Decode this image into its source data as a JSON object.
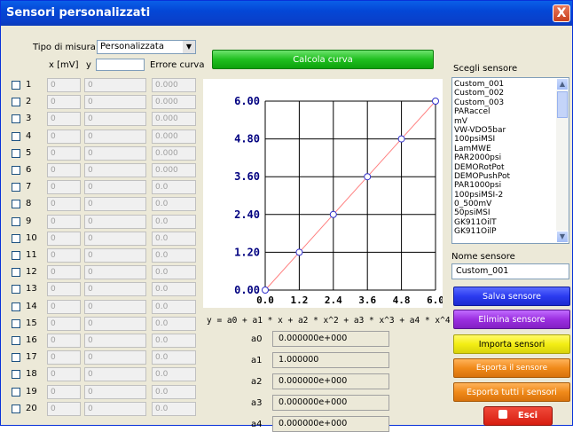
{
  "window": {
    "title": "Sensori personalizzati",
    "close_glyph": "X"
  },
  "measure": {
    "label": "Tipo di misura",
    "selected": "Personalizzata",
    "arrow": "▼"
  },
  "columns": {
    "x": "x [mV]",
    "y": "y",
    "err": "Errore curva"
  },
  "rows": [
    {
      "num": "1",
      "x": "0",
      "y": "0",
      "err": "0.000"
    },
    {
      "num": "2",
      "x": "0",
      "y": "0",
      "err": "0.000"
    },
    {
      "num": "3",
      "x": "0",
      "y": "0",
      "err": "0.000"
    },
    {
      "num": "4",
      "x": "0",
      "y": "0",
      "err": "0.000"
    },
    {
      "num": "5",
      "x": "0",
      "y": "0",
      "err": "0.000"
    },
    {
      "num": "6",
      "x": "0",
      "y": "0",
      "err": "0.000"
    },
    {
      "num": "7",
      "x": "0",
      "y": "0",
      "err": "0.0"
    },
    {
      "num": "8",
      "x": "0",
      "y": "0",
      "err": "0.0"
    },
    {
      "num": "9",
      "x": "0",
      "y": "0",
      "err": "0.0"
    },
    {
      "num": "10",
      "x": "0",
      "y": "0",
      "err": "0.0"
    },
    {
      "num": "11",
      "x": "0",
      "y": "0",
      "err": "0.0"
    },
    {
      "num": "12",
      "x": "0",
      "y": "0",
      "err": "0.0"
    },
    {
      "num": "13",
      "x": "0",
      "y": "0",
      "err": "0.0"
    },
    {
      "num": "14",
      "x": "0",
      "y": "0",
      "err": "0.0"
    },
    {
      "num": "15",
      "x": "0",
      "y": "0",
      "err": "0.0"
    },
    {
      "num": "16",
      "x": "0",
      "y": "0",
      "err": "0.0"
    },
    {
      "num": "17",
      "x": "0",
      "y": "0",
      "err": "0.0"
    },
    {
      "num": "18",
      "x": "0",
      "y": "0",
      "err": "0.0"
    },
    {
      "num": "19",
      "x": "0",
      "y": "0",
      "err": "0.0"
    },
    {
      "num": "20",
      "x": "0",
      "y": "0",
      "err": "0.0"
    }
  ],
  "calc_button": "Calcola curva",
  "chart_data": {
    "type": "line",
    "x": [
      0.0,
      1.2,
      2.4,
      3.6,
      4.8,
      6.0
    ],
    "y": [
      0.0,
      1.2,
      2.4,
      3.6,
      4.8,
      6.0
    ],
    "xticks": [
      "0.0",
      "1.2",
      "2.4",
      "3.6",
      "4.8",
      "6.0"
    ],
    "yticks": [
      "0.00",
      "1.20",
      "2.40",
      "3.60",
      "4.80",
      "6.00"
    ],
    "xlim": [
      0,
      6.0
    ],
    "ylim": [
      0,
      6.0
    ],
    "grid": true,
    "line_color": "#ff8080",
    "marker_color": "#3333cc",
    "label_color": "#000080"
  },
  "equation": "y = a0 + a1 * x + a2 * x^2 + a3 * x^3 + a4 * x^4",
  "coefficients": [
    {
      "name": "a0",
      "value": "0.000000e+000"
    },
    {
      "name": "a1",
      "value": "1.000000"
    },
    {
      "name": "a2",
      "value": "0.000000e+000"
    },
    {
      "name": "a3",
      "value": "0.000000e+000"
    },
    {
      "name": "a4",
      "value": "0.000000e+000"
    }
  ],
  "sensor_list": {
    "label": "Scegli sensore",
    "items": [
      "Custom_001",
      "Custom_002",
      "Custom_003",
      "PARaccel",
      "mV",
      "VW-VDO5bar",
      "100psiMSI",
      "LamMWE",
      "PAR2000psi",
      "DEMORotPot",
      "DEMOPushPot",
      "PAR1000psi",
      "100psiMSI-2",
      "0_500mV",
      "50psiMSI",
      "GK911OilT",
      "GK911OilP"
    ]
  },
  "sensor_name": {
    "label": "Nome sensore",
    "value": "Custom_001"
  },
  "buttons": {
    "save": "Salva sensore",
    "delete": "Elimina sensore",
    "import": "Importa sensori",
    "export_selected": "Esporta il sensore selezionato",
    "export_all": "Esporta tutti i sensori",
    "exit": "Esci"
  },
  "colors": {
    "save": "#2b3bf0",
    "delete": "#9b2fe0",
    "import": "#f3ee14",
    "export": "#f08a1a",
    "calc": "#1fbf1f",
    "exit": "#e02a1a"
  }
}
